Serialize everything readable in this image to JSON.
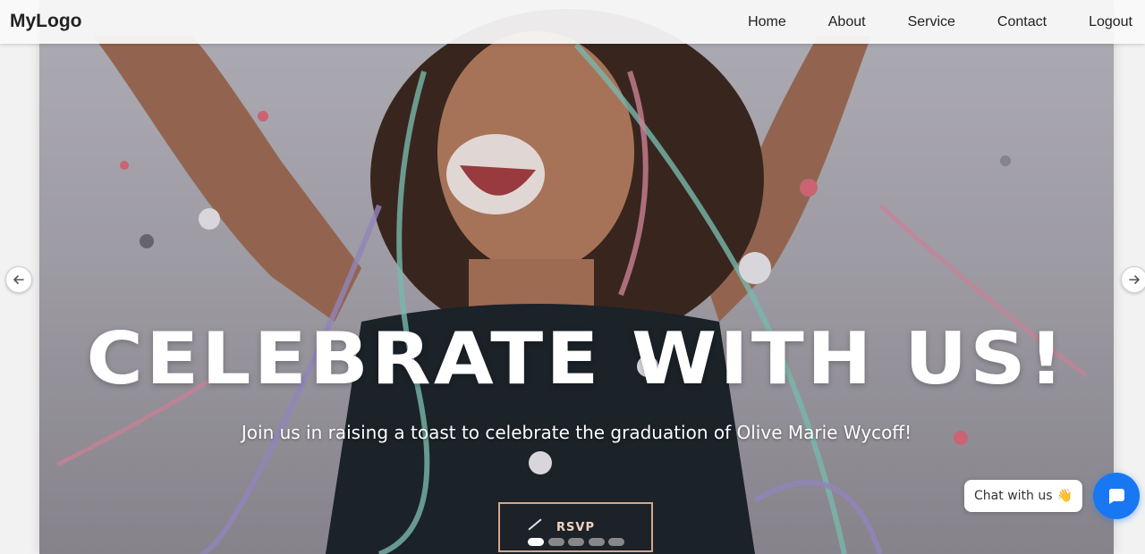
{
  "header": {
    "logo": "MyLogo",
    "nav": [
      "Home",
      "About",
      "Service",
      "Contact",
      "Logout"
    ]
  },
  "hero": {
    "headline": "CELEBRATE WITH US!",
    "subtitle": "Join us in raising a toast to celebrate the graduation of Olive Marie Wycoff!",
    "rsvp_label": "RSVP",
    "image": "celebration-photo"
  },
  "carousel": {
    "slides": 5,
    "active_slide": 1,
    "prev_icon": "arrow-left-icon",
    "next_icon": "arrow-right-icon"
  },
  "chat": {
    "label": "Chat with us",
    "emoji": "👋",
    "icon": "chat-icon"
  },
  "colors": {
    "chat_accent": "#1877f2",
    "rsvp_border": "#d9a58a"
  }
}
